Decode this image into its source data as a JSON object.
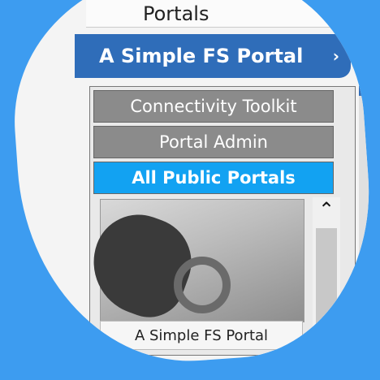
{
  "window": {
    "top_text": "Portals",
    "title": "A Simple FS Portal",
    "title_caret": "›"
  },
  "nav": {
    "items": [
      {
        "label": "Connectivity Toolkit",
        "state": "normal"
      },
      {
        "label": "Portal Admin",
        "state": "normal"
      },
      {
        "label": "All Public Portals",
        "state": "active"
      }
    ]
  },
  "portal_list": {
    "items": [
      {
        "label": "A Simple FS Portal",
        "thumbnail": "portal-thumbnail"
      }
    ],
    "scroll_up_icon": "⌃"
  },
  "colors": {
    "background": "#3d9cf0",
    "title_bar": "#2f6db9",
    "nav_gray": "#8b8b8b",
    "nav_active": "#12a2f2"
  },
  "icons": {
    "folder": "folder-icon"
  }
}
